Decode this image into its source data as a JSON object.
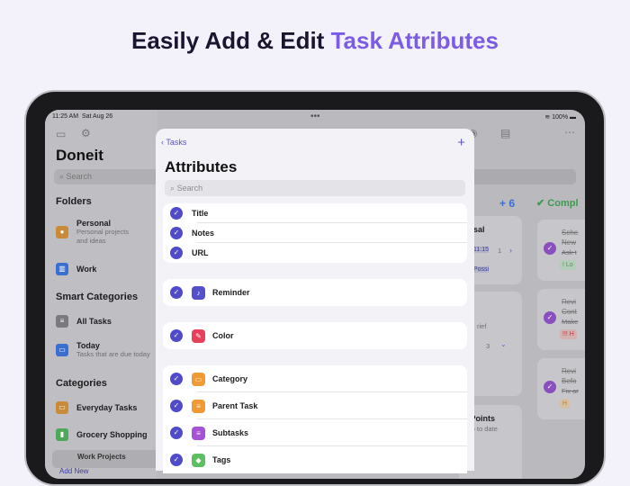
{
  "headline": {
    "prefix": "Easily Add & Edit ",
    "accent": "Task Attributes"
  },
  "colors": {
    "accent": "#7c5ce6",
    "check": "#4f4bc9"
  },
  "status": {
    "time": "11:25 AM",
    "date": "Sat Aug 26",
    "battery": "100%"
  },
  "sidebar": {
    "title": "Doneit",
    "search_placeholder": "Search",
    "folders_heading": "Folders",
    "folders": [
      {
        "label": "Personal",
        "sub1": "Personal projects",
        "sub2": "and ideas"
      },
      {
        "label": "Work"
      }
    ],
    "smart_heading": "Smart Categories",
    "smart": [
      {
        "label": "All Tasks"
      },
      {
        "label": "Today",
        "sub": "Tasks that are due today"
      }
    ],
    "categories_heading": "Categories",
    "categories": [
      {
        "label": "Everyday Tasks"
      },
      {
        "label": "Grocery Shopping"
      },
      {
        "label": "Work Projects"
      }
    ],
    "add_new": "Add New"
  },
  "board": {
    "count": "6",
    "completed": "Compl",
    "frag": [
      "sal",
      "11:15",
      "Possi",
      "1",
      "rief",
      "3",
      "ta Points",
      "is up to date"
    ],
    "done": [
      {
        "t1": "Sche",
        "t2": "New",
        "n": "Ask t",
        "tag": "! Lo"
      },
      {
        "t1": "Revi",
        "t2": "Cont",
        "n": "Make",
        "tag": "!!! H"
      },
      {
        "t1": "Revi",
        "t2": "Befo",
        "n": "Fix ar",
        "tag": "H"
      }
    ]
  },
  "sheet": {
    "back": "Tasks",
    "title": "Attributes",
    "search_placeholder": "Search",
    "group1": [
      "Title",
      "Notes",
      "URL"
    ],
    "reminder": "Reminder",
    "color": "Color",
    "group3": [
      "Category",
      "Parent Task",
      "Subtasks",
      "Tags"
    ]
  }
}
